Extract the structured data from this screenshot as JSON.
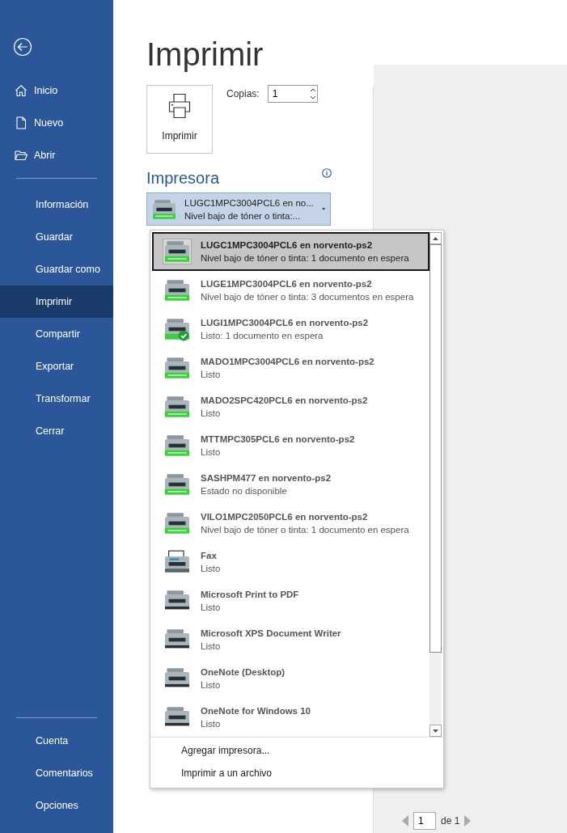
{
  "sidebar": {
    "back": {
      "kind": "back"
    },
    "top": [
      {
        "label": "Inicio",
        "selected": false
      },
      {
        "label": "Nuevo",
        "selected": false
      },
      {
        "label": "Abrir",
        "selected": false
      }
    ],
    "middle": [
      {
        "label": "Información",
        "selected": false
      },
      {
        "label": "Guardar",
        "selected": false
      },
      {
        "label": "Guardar como",
        "selected": false
      },
      {
        "label": "Imprimir",
        "selected": true
      },
      {
        "label": "Compartir",
        "selected": false
      },
      {
        "label": "Exportar",
        "selected": false
      },
      {
        "label": "Transformar",
        "selected": false
      },
      {
        "label": "Cerrar",
        "selected": false
      }
    ],
    "bottom": [
      {
        "label": "Cuenta",
        "selected": false
      },
      {
        "label": "Comentarios",
        "selected": false
      },
      {
        "label": "Opciones",
        "selected": false
      }
    ]
  },
  "title": "Imprimir",
  "print_button": {
    "label": "Imprimir"
  },
  "copies": {
    "label": "Copias:",
    "value": "1"
  },
  "printer_section": {
    "heading": "Impresora"
  },
  "printer_select": {
    "name": "LUGC1MPC3004PCL6 en no...",
    "status": "Nivel bajo de tóner o tinta:...",
    "kind": "green"
  },
  "printer_list": [
    {
      "name": "LUGC1MPC3004PCL6 en norvento-ps2",
      "status": "Nivel bajo de tóner o tinta: 1 documento en espera",
      "kind": "green",
      "selected": true
    },
    {
      "name": "LUGE1MPC3004PCL6 en norvento-ps2",
      "status": "Nivel bajo de tóner o tinta: 3 documentos en espera",
      "kind": "green",
      "selected": false
    },
    {
      "name": "LUGI1MPC3004PCL6 en norvento-ps2",
      "status": "Listo: 1 documento en espera",
      "kind": "default",
      "selected": false
    },
    {
      "name": "MADO1MPC3004PCL6 en norvento-ps2",
      "status": "Listo",
      "kind": "green",
      "selected": false
    },
    {
      "name": "MADO2SPC420PCL6 en norvento-ps2",
      "status": "Listo",
      "kind": "green",
      "selected": false
    },
    {
      "name": "MTTMPC305PCL6 en norvento-ps2",
      "status": "Listo",
      "kind": "green",
      "selected": false
    },
    {
      "name": "SASHPM477 en norvento-ps2",
      "status": "Estado no disponible",
      "kind": "green",
      "selected": false
    },
    {
      "name": "VILO1MPC2050PCL6 en norvento-ps2",
      "status": "Nivel bajo de tóner o tinta: 1 documento en espera",
      "kind": "green",
      "selected": false
    },
    {
      "name": "Fax",
      "status": "Listo",
      "kind": "fax",
      "selected": false
    },
    {
      "name": "Microsoft Print to PDF",
      "status": "Listo",
      "kind": "plain",
      "selected": false
    },
    {
      "name": "Microsoft XPS Document Writer",
      "status": "Listo",
      "kind": "plain",
      "selected": false
    },
    {
      "name": "OneNote (Desktop)",
      "status": "Listo",
      "kind": "plain",
      "selected": false
    },
    {
      "name": "OneNote for Windows 10",
      "status": "Listo",
      "kind": "plain",
      "selected": false
    }
  ],
  "printer_actions": [
    "Agregar impresora...",
    "Imprimir a un archivo"
  ],
  "page_nav": {
    "value": "1",
    "total": "de 1"
  }
}
